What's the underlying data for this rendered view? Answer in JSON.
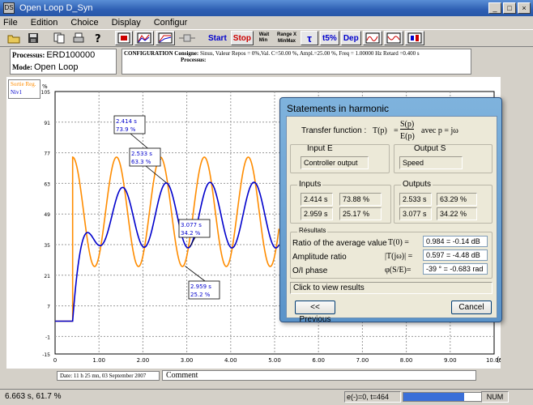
{
  "window": {
    "title": "Open Loop D_Syn",
    "controls": [
      "_",
      "□",
      "×"
    ]
  },
  "menu": [
    "File",
    "Edition",
    "Choice",
    "Display",
    "Configur"
  ],
  "toolbar": {
    "start_label": "Start",
    "stop_label": "Stop",
    "tau_label": "τ",
    "t5_label": "t5%",
    "dep_label": "Dep",
    "icons": [
      "open-icon",
      "save-icon",
      "copy-icon",
      "print-icon",
      "help-icon",
      "process-icon",
      "chart-icon",
      "chart2-icon",
      "transfer-icon",
      "scale-icon",
      "minmax-icon",
      "bode-icon",
      "nyquist-icon",
      "diagram-icon"
    ],
    "wait_min": "Wait\nMin",
    "range_x": "Range X",
    "minmax": "MinMax"
  },
  "process": {
    "process_label": "Processus:",
    "process_value": "ERD100000",
    "mode_label": "Mode:",
    "mode_value": "Open Loop"
  },
  "config": {
    "label": "CONFIGURATION",
    "consigne_label": "Consigne:",
    "consigne_value": "Sinus, Valeur Repos = 0%,Val. C=50.00 %, Ampl.=25.00 %, Freq = 1.00000 Hz Retard =0.400 s",
    "processus_label": "Processus:"
  },
  "legend": {
    "line1": "Sortie Reg.",
    "line2": "Niv1"
  },
  "chart_data": {
    "type": "line",
    "x_unit": "(s)",
    "y_unit": "%",
    "xlim": [
      0,
      10
    ],
    "ylim": [
      -15,
      105
    ],
    "x_ticks": [
      "0",
      "1.00",
      "2.00",
      "3.00",
      "4.00",
      "5.00",
      "6.00",
      "7.00",
      "8.00",
      "9.00",
      "10.00"
    ],
    "y_ticks": [
      "105",
      "91",
      "77",
      "63",
      "49",
      "35",
      "21",
      "7",
      "-7",
      "-15"
    ],
    "y_tick_values": [
      105,
      91,
      77,
      63,
      49,
      35,
      21,
      7,
      -7,
      -15
    ],
    "y_tick_labels": [
      "105",
      "91",
      "77",
      "63",
      "49",
      "35",
      "21",
      "7",
      "-1",
      "-15"
    ],
    "grid": true,
    "series": [
      {
        "name": "Sortie Reg.",
        "color": "#ff8c00",
        "kind": "sine",
        "start": 0.4,
        "end": 5.1,
        "offset": 50,
        "amplitude": 25,
        "freq": 1.0
      },
      {
        "name": "Niv1",
        "color": "#0000cc",
        "kind": "response",
        "start": 0.4,
        "end": 5.1,
        "offset": 48.5,
        "amplitude": 15,
        "freq": 1.0,
        "lag": 0.13
      }
    ],
    "annotations": [
      {
        "t": "2.414 s",
        "v": "73.9 %",
        "x": 2.414,
        "y": 73.9
      },
      {
        "t": "2.533 s",
        "v": "63.3 %",
        "x": 2.533,
        "y": 63.3
      },
      {
        "t": "3.077 s",
        "v": "34.2 %",
        "x": 3.077,
        "y": 34.2
      },
      {
        "t": "2.959 s",
        "v": "25.2 %",
        "x": 2.959,
        "y": 25.2
      }
    ]
  },
  "footer": {
    "date": "Date: 11 h 25 mn, 03 September 2007",
    "comment": "Comment"
  },
  "status": {
    "coords": "6.663 s, 61.7 %",
    "err": "e(-)=0, t=464",
    "progress": 0.78,
    "num": "NUM"
  },
  "dialog": {
    "title": "Statements in harmonic",
    "tf_label": "Transfer function :",
    "tf_formula_lhs": "T(p)",
    "tf_formula_num": "S(p)",
    "tf_formula_den": "E(p)",
    "tf_formula_tail": "avec  p = jω",
    "input_label": "Input E",
    "input_value": "Controller output",
    "output_label": "Output S",
    "output_value": "Speed",
    "inputs_label": "Inputs",
    "outputs_label": "Outputs",
    "inputs": [
      [
        "2.414 s",
        "73.88 %"
      ],
      [
        "2.959 s",
        "25.17 %"
      ]
    ],
    "outputs": [
      [
        "2.533 s",
        "63.29 %"
      ],
      [
        "3.077 s",
        "34.22 %"
      ]
    ],
    "results_label": "Résultats",
    "avg_label": "Ratio of the average value",
    "avg_symbol": "T(0) =",
    "avg_value": "0.984 = -0.14 dB",
    "amp_label": "Amplitude ratio",
    "amp_symbol": "|T(jω)| =",
    "amp_value": "0.597 = -4.48 dB",
    "phase_label": "O/I phase",
    "phase_symbol": "φ(S/E)=",
    "phase_value": "-39 ° = -0.683 rad",
    "hint": "Click to view results",
    "prev_button": "<< Previous",
    "cancel_button": "Cancel"
  }
}
